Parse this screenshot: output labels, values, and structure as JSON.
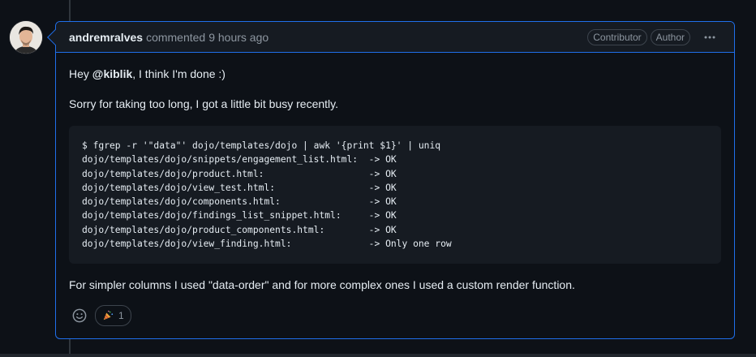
{
  "comment": {
    "author": "andremralves",
    "action": "commented",
    "time": "9 hours ago",
    "badges": [
      "Contributor",
      "Author"
    ],
    "menu_icon": "kebab-horizontal-icon",
    "body": {
      "greeting_prefix": "Hey ",
      "mention": "@kiblik",
      "greeting_suffix": ", I think I'm done :)",
      "paragraph_2": "Sorry for taking too long, I got a little bit busy recently.",
      "code_lines": [
        "$ fgrep -r '\"data\"' dojo/templates/dojo | awk '{print $1}' | uniq",
        "dojo/templates/dojo/snippets/engagement_list.html:  -> OK",
        "dojo/templates/dojo/product.html:                   -> OK",
        "dojo/templates/dojo/view_test.html:                 -> OK",
        "dojo/templates/dojo/components.html:                -> OK",
        "dojo/templates/dojo/findings_list_snippet.html:     -> OK",
        "dojo/templates/dojo/product_components.html:        -> OK",
        "dojo/templates/dojo/view_finding.html:              -> Only one row"
      ],
      "paragraph_3": "For simpler columns I used \"data-order\" and for more complex ones I used a custom render function."
    },
    "reactions": [
      {
        "icon": "party-popper-icon",
        "emoji": "🎉",
        "count": "1"
      }
    ]
  },
  "colors": {
    "background": "#0d1117",
    "header_background": "#161b22",
    "accent_border": "#1f6feb",
    "muted_text": "#8d96a0",
    "text": "#e6edf3"
  }
}
